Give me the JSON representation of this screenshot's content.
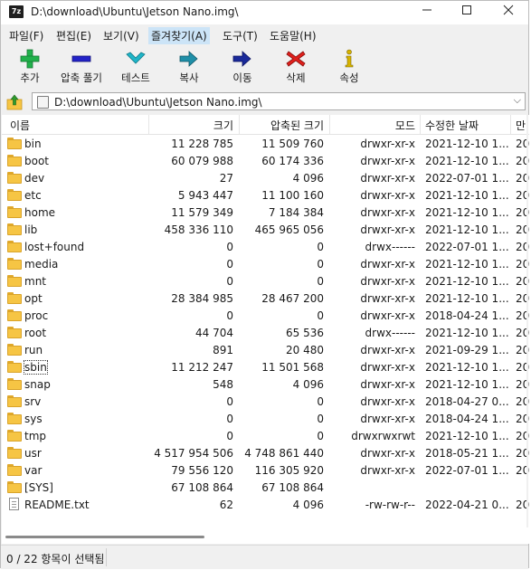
{
  "window": {
    "title": "D:\\download\\Ubuntu\\Jetson Nano.img\\",
    "icon_text": "7z",
    "controls": [
      "minimize",
      "maximize",
      "close"
    ]
  },
  "menu": [
    {
      "label": "파일(F)"
    },
    {
      "label": "편집(E)"
    },
    {
      "label": "보기(V)"
    },
    {
      "label": "즐겨찾기(A)"
    },
    {
      "label": "도구(T)"
    },
    {
      "label": "도움말(H)"
    }
  ],
  "toolbar": [
    {
      "label": "추가",
      "icon": "plus-icon",
      "color": "#22b14c"
    },
    {
      "label": "압축 풀기",
      "icon": "minus-icon",
      "color": "#2323c8"
    },
    {
      "label": "테스트",
      "icon": "check-chevron-icon",
      "color": "#1fb5c8"
    },
    {
      "label": "복사",
      "icon": "copy-arrow-icon",
      "color": "#1f8fa8"
    },
    {
      "label": "이동",
      "icon": "move-arrow-icon",
      "color": "#1a2a9a"
    },
    {
      "label": "삭제",
      "icon": "delete-x-icon",
      "color": "#e0201c"
    },
    {
      "label": "속성",
      "icon": "info-icon",
      "color": "#d8b400"
    }
  ],
  "address": {
    "path": "D:\\download\\Ubuntu\\Jetson Nano.img\\"
  },
  "columns": {
    "name": "이름",
    "size": "크기",
    "packed": "압축된 크기",
    "mode": "모드",
    "modified": "수정한 날짜",
    "extra": "만"
  },
  "files": [
    {
      "name": "bin",
      "type": "folder",
      "size": "11 228 785",
      "packed": "11 509 760",
      "mode": "drwxr-xr-x",
      "modified": "2021-12-10 1...",
      "extra": "20"
    },
    {
      "name": "boot",
      "type": "folder",
      "size": "60 079 988",
      "packed": "60 174 336",
      "mode": "drwxr-xr-x",
      "modified": "2021-12-10 1...",
      "extra": "20"
    },
    {
      "name": "dev",
      "type": "folder",
      "size": "27",
      "packed": "4 096",
      "mode": "drwxr-xr-x",
      "modified": "2022-07-01 1...",
      "extra": "20"
    },
    {
      "name": "etc",
      "type": "folder",
      "size": "5 943 447",
      "packed": "11 100 160",
      "mode": "drwxr-xr-x",
      "modified": "2021-12-10 1...",
      "extra": "20"
    },
    {
      "name": "home",
      "type": "folder",
      "size": "11 579 349",
      "packed": "7 184 384",
      "mode": "drwxr-xr-x",
      "modified": "2021-12-10 1...",
      "extra": "20"
    },
    {
      "name": "lib",
      "type": "folder",
      "size": "458 336 110",
      "packed": "465 965 056",
      "mode": "drwxr-xr-x",
      "modified": "2021-12-10 1...",
      "extra": "20"
    },
    {
      "name": "lost+found",
      "type": "folder",
      "size": "0",
      "packed": "0",
      "mode": "drwx------",
      "modified": "2022-07-01 1...",
      "extra": "20"
    },
    {
      "name": "media",
      "type": "folder",
      "size": "0",
      "packed": "0",
      "mode": "drwxr-xr-x",
      "modified": "2021-12-10 1...",
      "extra": "20"
    },
    {
      "name": "mnt",
      "type": "folder",
      "size": "0",
      "packed": "0",
      "mode": "drwxr-xr-x",
      "modified": "2021-12-10 1...",
      "extra": "20"
    },
    {
      "name": "opt",
      "type": "folder",
      "size": "28 384 985",
      "packed": "28 467 200",
      "mode": "drwxr-xr-x",
      "modified": "2021-12-10 1...",
      "extra": "20"
    },
    {
      "name": "proc",
      "type": "folder",
      "size": "0",
      "packed": "0",
      "mode": "drwxr-xr-x",
      "modified": "2018-04-24 1...",
      "extra": "20"
    },
    {
      "name": "root",
      "type": "folder",
      "size": "44 704",
      "packed": "65 536",
      "mode": "drwx------",
      "modified": "2021-12-10 1...",
      "extra": "20"
    },
    {
      "name": "run",
      "type": "folder",
      "size": "891",
      "packed": "20 480",
      "mode": "drwxr-xr-x",
      "modified": "2021-09-29 1...",
      "extra": "20"
    },
    {
      "name": "sbin",
      "type": "folder",
      "size": "11 212 247",
      "packed": "11 501 568",
      "mode": "drwxr-xr-x",
      "modified": "2021-12-10 1...",
      "extra": "20",
      "focused": true
    },
    {
      "name": "snap",
      "type": "folder",
      "size": "548",
      "packed": "4 096",
      "mode": "drwxr-xr-x",
      "modified": "2021-12-10 1...",
      "extra": "20"
    },
    {
      "name": "srv",
      "type": "folder",
      "size": "0",
      "packed": "0",
      "mode": "drwxr-xr-x",
      "modified": "2018-04-27 0...",
      "extra": "20"
    },
    {
      "name": "sys",
      "type": "folder",
      "size": "0",
      "packed": "0",
      "mode": "drwxr-xr-x",
      "modified": "2018-04-24 1...",
      "extra": "20"
    },
    {
      "name": "tmp",
      "type": "folder",
      "size": "0",
      "packed": "0",
      "mode": "drwxrwxrwt",
      "modified": "2021-12-10 1...",
      "extra": "20"
    },
    {
      "name": "usr",
      "type": "folder",
      "size": "4 517 954 506",
      "packed": "4 748 861 440",
      "mode": "drwxr-xr-x",
      "modified": "2018-05-21 1...",
      "extra": "20"
    },
    {
      "name": "var",
      "type": "folder",
      "size": "79 556 120",
      "packed": "116 305 920",
      "mode": "drwxr-xr-x",
      "modified": "2022-07-01 1...",
      "extra": "20"
    },
    {
      "name": "[SYS]",
      "type": "folder",
      "size": "67 108 864",
      "packed": "67 108 864",
      "mode": "",
      "modified": "",
      "extra": ""
    },
    {
      "name": "README.txt",
      "type": "file",
      "size": "62",
      "packed": "4 096",
      "mode": "-rw-rw-r--",
      "modified": "2022-04-21 0...",
      "extra": "20"
    }
  ],
  "status": {
    "selection": "0 / 22 항목이 선택됨"
  }
}
